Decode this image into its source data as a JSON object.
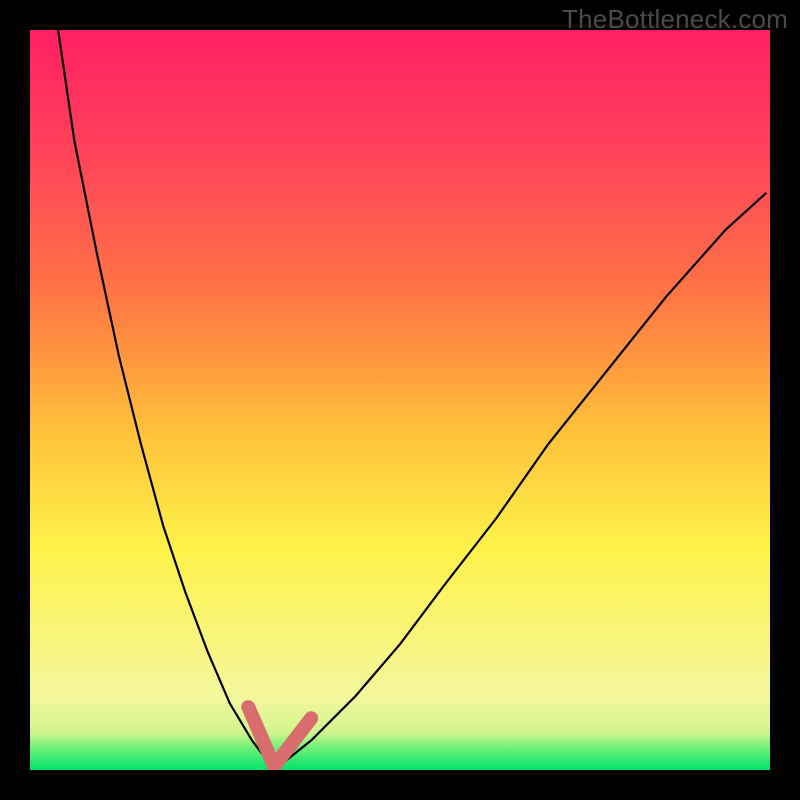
{
  "watermark": "TheBottleneck.com",
  "colors": {
    "background": "#000000",
    "gradient_top": "#ff1f64",
    "gradient_mid": "#fef24a",
    "gradient_bottom": "#01e26a",
    "curve": "#000000",
    "marker": "#d96d6d"
  },
  "chart_data": {
    "type": "line",
    "title": "",
    "xlabel": "",
    "ylabel": "",
    "xlim": [
      0,
      100
    ],
    "ylim": [
      0,
      100
    ],
    "note": "Axes unlabeled; values are relative % of plot width/height read off the figure. y=0 is the bottom (green), y=100 is the top (red). Both curves intersect at the minimum ~x=33, y=0 (bottom edge).",
    "series": [
      {
        "name": "left-curve",
        "x": [
          3.8,
          6,
          9,
          12,
          15,
          18,
          21,
          24,
          27,
          30,
          33
        ],
        "y": [
          100,
          85,
          70,
          56,
          44,
          33,
          24,
          16,
          9,
          4,
          0
        ]
      },
      {
        "name": "right-curve",
        "x": [
          33,
          38,
          44,
          50,
          56,
          63,
          70,
          78,
          86,
          94,
          99.5
        ],
        "y": [
          0,
          4,
          10,
          17,
          25,
          34,
          44,
          54,
          64,
          73,
          78
        ]
      }
    ],
    "annotations": [
      {
        "name": "v-marker",
        "shape": "v",
        "vertices_x": [
          29.5,
          33.0,
          38.0
        ],
        "vertices_y": [
          8.5,
          0.5,
          7.0
        ]
      }
    ]
  }
}
